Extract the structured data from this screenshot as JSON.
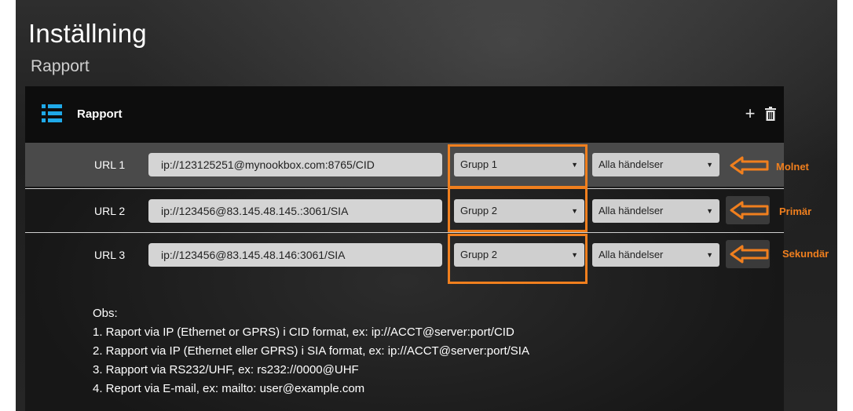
{
  "page": {
    "title": "Inställning",
    "subtitle": "Rapport"
  },
  "panel": {
    "header_title": "Rapport",
    "icons": [
      "list-icon",
      "plus-icon",
      "trash-icon"
    ],
    "add_label": "+"
  },
  "rows": [
    {
      "label": "URL 1",
      "value": "ip://123125251@mynookbox.com:8765/CID",
      "group": "Grupp 1",
      "events": "Alla händelser"
    },
    {
      "label": "URL 2",
      "value": "ip://123456@83.145.48.145.:3061/SIA",
      "group": "Grupp 2",
      "events": "Alla händelser"
    },
    {
      "label": "URL 3",
      "value": "ip://123456@83.145.48.146:3061/SIA",
      "group": "Grupp 2",
      "events": "Alla händelser"
    }
  ],
  "annotations": {
    "labels": [
      "Molnet",
      "Primär",
      "Sekundär"
    ],
    "color": "#f07f1e"
  },
  "notes": {
    "heading": "Obs:",
    "lines": [
      "1. Raport via IP (Ethernet or GPRS) i CID format, ex: ip://ACCT@server:port/CID",
      "2. Rapport via IP (Ethernet eller GPRS) i SIA format, ex: ip://ACCT@server:port/SIA",
      "3. Rapport via RS232/UHF, ex: rs232://0000@UHF",
      "4. Report via E-mail, ex: mailto: user@example.com"
    ]
  }
}
